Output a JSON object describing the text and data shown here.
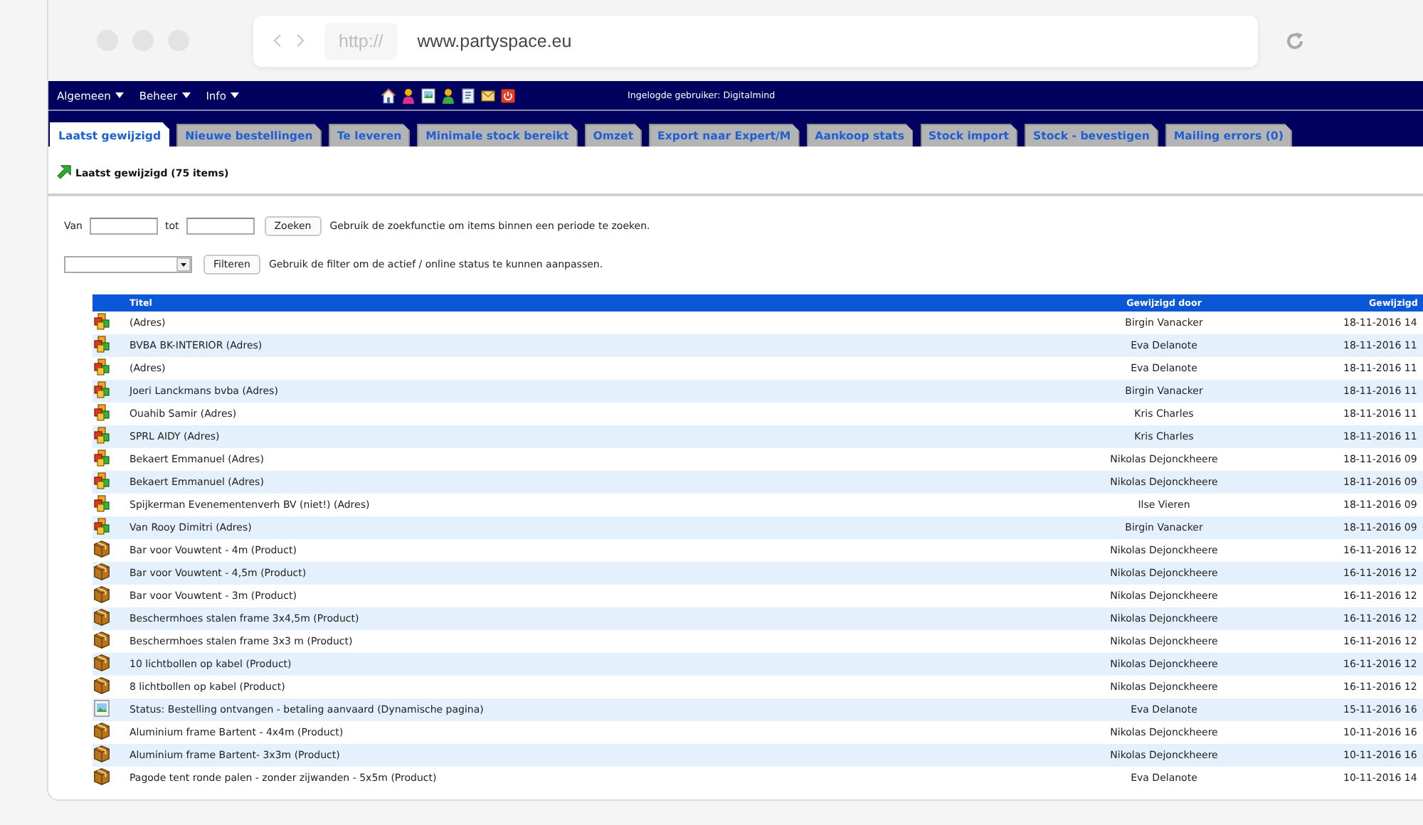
{
  "browser": {
    "protocol": "http://",
    "url": "www.partyspace.eu"
  },
  "menu": [
    {
      "label": "Algemeen"
    },
    {
      "label": "Beheer"
    },
    {
      "label": "Info"
    }
  ],
  "user_label": "Ingelogde gebruiker: Digitalmind",
  "tabs": [
    {
      "label": "Laatst gewijzigd",
      "selected": true
    },
    {
      "label": "Nieuwe bestellingen",
      "selected": false
    },
    {
      "label": "Te leveren",
      "selected": false
    },
    {
      "label": "Minimale stock bereikt",
      "selected": false
    },
    {
      "label": "Omzet",
      "selected": false
    },
    {
      "label": "Export naar Expert/M",
      "selected": false
    },
    {
      "label": "Aankoop stats",
      "selected": false
    },
    {
      "label": "Stock import",
      "selected": false
    },
    {
      "label": "Stock - bevestigen",
      "selected": false
    },
    {
      "label": "Mailing errors (0)",
      "selected": false
    }
  ],
  "page_title": "Laatst gewijzigd (75 items)",
  "search": {
    "from_label": "Van",
    "to_label": "tot",
    "button": "Zoeken",
    "hint": "Gebruik de zoekfunctie om items binnen een periode te zoeken."
  },
  "filter": {
    "button": "Filteren",
    "hint": "Gebruik de filter om de actief / online status te kunnen aanpassen."
  },
  "table": {
    "columns": [
      {
        "label": "Titel"
      },
      {
        "label": "Gewijzigd door"
      },
      {
        "label": "Gewijzigd"
      }
    ],
    "rows": [
      {
        "kind": "address",
        "title": "(Adres)",
        "modified_by": "Birgin Vanacker",
        "modified_on": "18-11-2016 14"
      },
      {
        "kind": "address",
        "title": "BVBA BK-INTERIOR (Adres)",
        "modified_by": "Eva Delanote",
        "modified_on": "18-11-2016 11"
      },
      {
        "kind": "address",
        "title": "(Adres)",
        "modified_by": "Eva Delanote",
        "modified_on": "18-11-2016 11"
      },
      {
        "kind": "address",
        "title": "Joeri Lanckmans bvba (Adres)",
        "modified_by": "Birgin Vanacker",
        "modified_on": "18-11-2016 11"
      },
      {
        "kind": "address",
        "title": "Ouahib Samir (Adres)",
        "modified_by": "Kris Charles",
        "modified_on": "18-11-2016 11"
      },
      {
        "kind": "address",
        "title": "SPRL AIDY (Adres)",
        "modified_by": "Kris Charles",
        "modified_on": "18-11-2016 11"
      },
      {
        "kind": "address",
        "title": "Bekaert Emmanuel (Adres)",
        "modified_by": "Nikolas Dejonckheere",
        "modified_on": "18-11-2016 09"
      },
      {
        "kind": "address",
        "title": "Bekaert Emmanuel (Adres)",
        "modified_by": "Nikolas Dejonckheere",
        "modified_on": "18-11-2016 09"
      },
      {
        "kind": "address",
        "title": "Spijkerman Evenementenverh BV (niet!) (Adres)",
        "modified_by": "Ilse Vieren",
        "modified_on": "18-11-2016 09"
      },
      {
        "kind": "address",
        "title": "Van Rooy Dimitri (Adres)",
        "modified_by": "Birgin Vanacker",
        "modified_on": "18-11-2016 09"
      },
      {
        "kind": "product",
        "title": "Bar voor Vouwtent - 4m (Product)",
        "modified_by": "Nikolas Dejonckheere",
        "modified_on": "16-11-2016 12"
      },
      {
        "kind": "product",
        "title": "Bar voor Vouwtent - 4,5m (Product)",
        "modified_by": "Nikolas Dejonckheere",
        "modified_on": "16-11-2016 12"
      },
      {
        "kind": "product",
        "title": "Bar voor Vouwtent - 3m (Product)",
        "modified_by": "Nikolas Dejonckheere",
        "modified_on": "16-11-2016 12"
      },
      {
        "kind": "product",
        "title": "Beschermhoes stalen frame 3x4,5m (Product)",
        "modified_by": "Nikolas Dejonckheere",
        "modified_on": "16-11-2016 12"
      },
      {
        "kind": "product",
        "title": "Beschermhoes stalen frame 3x3 m (Product)",
        "modified_by": "Nikolas Dejonckheere",
        "modified_on": "16-11-2016 12"
      },
      {
        "kind": "product",
        "title": "10 lichtbollen op kabel (Product)",
        "modified_by": "Nikolas Dejonckheere",
        "modified_on": "16-11-2016 12"
      },
      {
        "kind": "product",
        "title": "8 lichtbollen op kabel (Product)",
        "modified_by": "Nikolas Dejonckheere",
        "modified_on": "16-11-2016 12"
      },
      {
        "kind": "page",
        "title": "Status: Bestelling ontvangen - betaling aanvaard (Dynamische pagina)",
        "modified_by": "Eva Delanote",
        "modified_on": "15-11-2016 16"
      },
      {
        "kind": "product",
        "title": "Aluminium frame Bartent - 4x4m (Product)",
        "modified_by": "Nikolas Dejonckheere",
        "modified_on": "10-11-2016 16"
      },
      {
        "kind": "product",
        "title": "Aluminium frame Bartent- 3x3m (Product)",
        "modified_by": "Nikolas Dejonckheere",
        "modified_on": "10-11-2016 16"
      },
      {
        "kind": "product",
        "title": "Pagode tent ronde palen - zonder zijwanden - 5x5m (Product)",
        "modified_by": "Eva Delanote",
        "modified_on": "10-11-2016 14"
      }
    ]
  }
}
